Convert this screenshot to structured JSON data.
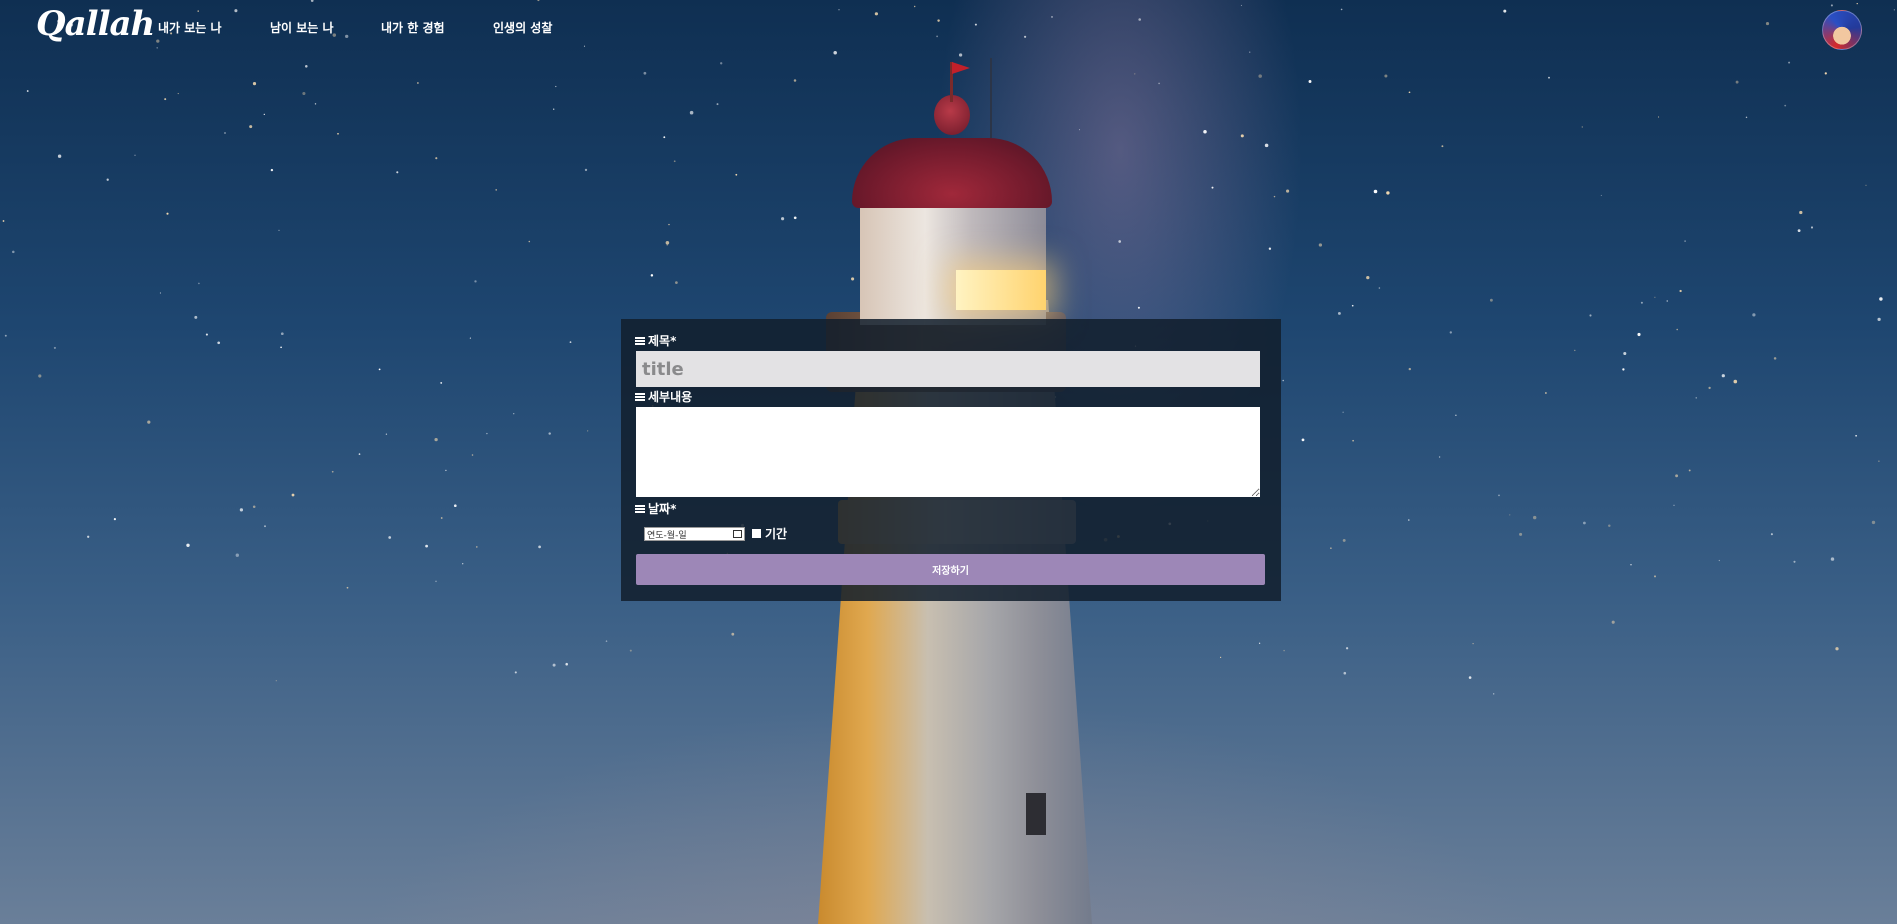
{
  "nav": {
    "logo": "Qallah",
    "links": [
      "내가 보는 나",
      "남이 보는 나",
      "내가 한 경험",
      "인생의 성찰"
    ]
  },
  "form": {
    "title_label": "제목*",
    "title_placeholder": "title",
    "detail_label": "세부내용",
    "date_label": "날짜*",
    "date_placeholder": "연도-월-일",
    "period_label": "기간",
    "save_label": "저장하기"
  },
  "colors": {
    "save_button": "#9d87b7",
    "panel": "#121e2c",
    "title_field": "#e3e2e4"
  },
  "icons": [
    "menu-icon",
    "calendar-icon",
    "user-avatar"
  ]
}
